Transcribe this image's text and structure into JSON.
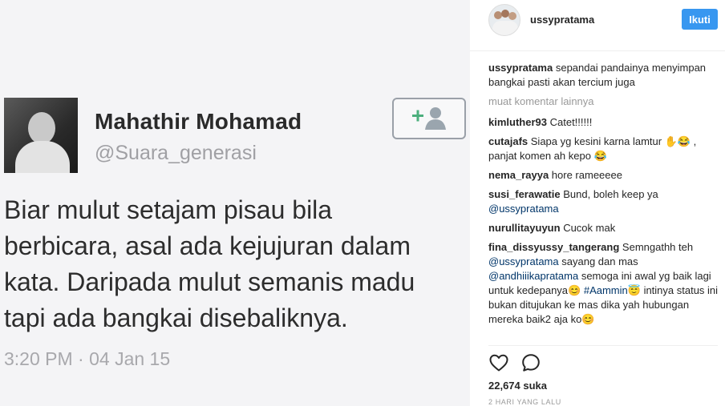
{
  "tweet": {
    "name": "Mahathir Mohamad",
    "handle": "@Suara_generasi",
    "lines": [
      "Biar mulut setajam pisau bila",
      "berbicara, asal ada kejujuran dalam",
      "kata. Daripada mulut semanis madu",
      "tapi ada bangkai disebaliknya."
    ],
    "time": "3:20 PM · 04 Jan 15",
    "follow_icon": "add-person-icon"
  },
  "header": {
    "username": "ussypratama",
    "follow_label": "Ikuti"
  },
  "caption": {
    "user": "ussypratama",
    "text": "sepandai pandainya menyimpan bangkai pasti akan tercium juga"
  },
  "load_more": "muat komentar lainnya",
  "comments": [
    {
      "user": "kimluther93",
      "text": "Catet!!!!!!"
    },
    {
      "user": "cutajafs",
      "text": "Siapa yg kesini karna lamtur ✋😂 , panjat komen ah kepo 😂"
    },
    {
      "user": "nema_rayya",
      "text": "hore rameeeee"
    },
    {
      "user": "susi_ferawatie",
      "text": "Bund, boleh keep ya",
      "mention": "@ussypratama"
    },
    {
      "user": "nurullitayuyun",
      "text": "Cucok mak"
    },
    {
      "user": "fina_dissyussy_tangerang",
      "text_a": "Semngathh teh",
      "mention_a": "@ussypratama",
      "text_b": "sayang dan mas",
      "mention_b": "@andhiiikapratama",
      "text_c": "semoga ini awal yg baik lagi untuk kedepanya😊",
      "hashtag": "#Aammin😇",
      "text_d": "intinya status ini bukan ditujukan ke mas dika yah hubungan mereka baik2 aja ko😊"
    }
  ],
  "actions": {
    "like_icon": "heart-icon",
    "comment_icon": "comment-icon"
  },
  "likes": "22,674 suka",
  "time_ago": "2 HARI YANG LALU",
  "colors": {
    "accent": "#3897f0",
    "link": "#003569",
    "text": "#262626",
    "muted": "#999999"
  }
}
